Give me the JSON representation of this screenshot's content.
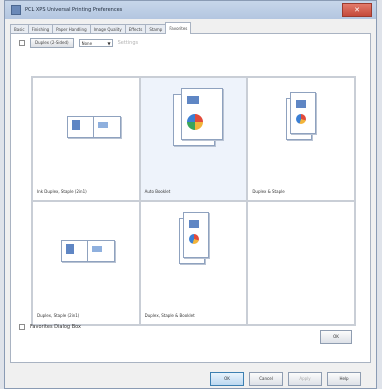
{
  "window": {
    "title": "PCL XPS Universal Printing Preferences",
    "close_label": "✕"
  },
  "tabs": [
    "Basic",
    "Finishing",
    "Paper Handling",
    "Image Quality",
    "Effects",
    "Stamp",
    "Favorites"
  ],
  "active_tab_index": 6,
  "toolbar": {
    "checkbox_label": "Duplex (2-Sided)",
    "dropdown_value": "None",
    "disabled_label": "Settings"
  },
  "presets": [
    {
      "label": "Ink Duplex, Staple (2in1)",
      "selected": false
    },
    {
      "label": "Auto Booklet",
      "selected": true
    },
    {
      "label": "Duplex & Staple",
      "selected": false
    },
    {
      "label": "Duplex, Staple (2in1)",
      "selected": false
    },
    {
      "label": "Duplex, Staple & Booklet",
      "selected": false
    },
    {
      "label": "",
      "selected": false
    }
  ],
  "bottom": {
    "checkbox_label": "Favorites Dialog Box",
    "ok_label": "OK"
  },
  "footer": {
    "ok": "OK",
    "cancel": "Cancel",
    "apply": "Apply",
    "help": "Help"
  },
  "colors": {
    "accent": "#3c7fb1",
    "title_bar": "#b3c6e0",
    "close_button": "#c44a3b"
  }
}
